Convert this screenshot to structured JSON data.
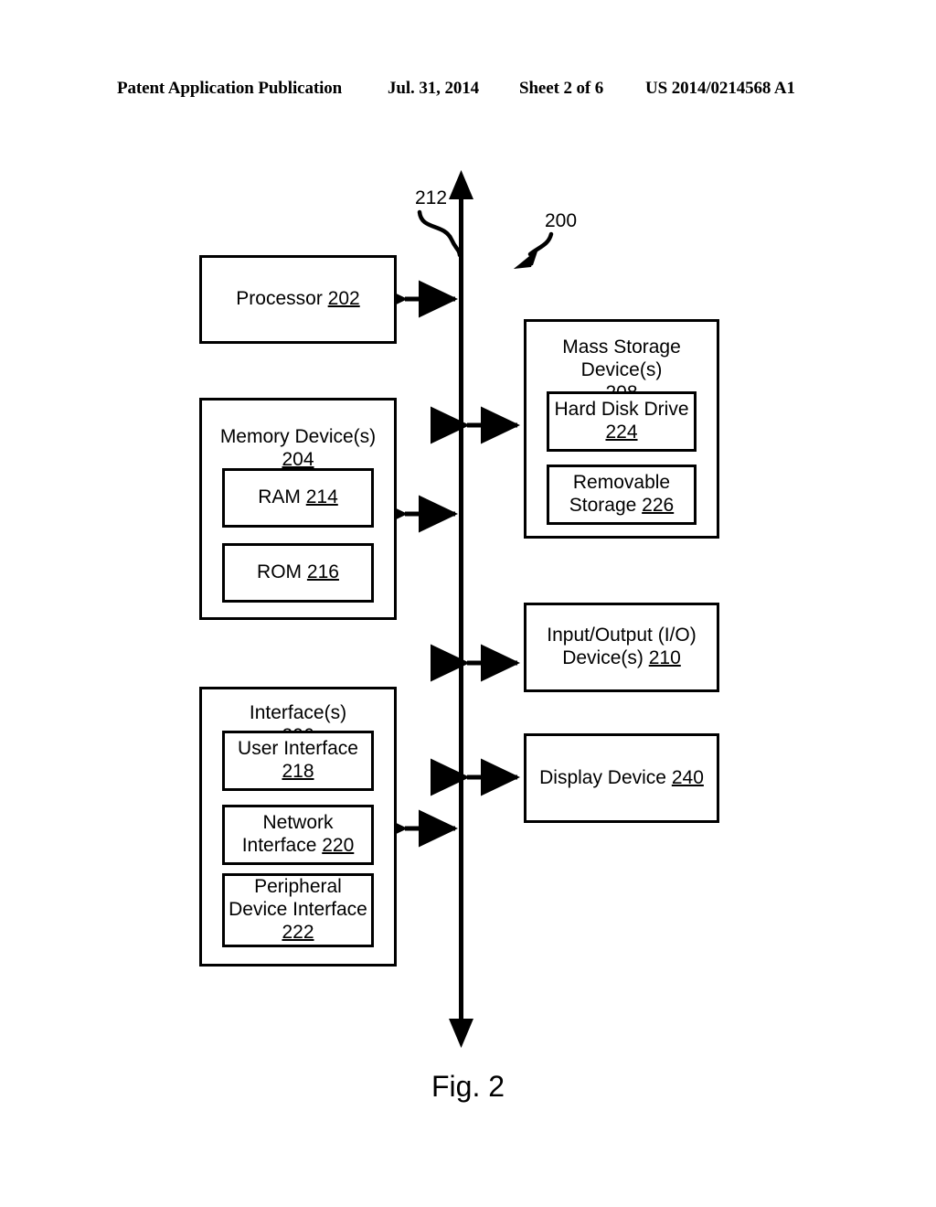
{
  "header": {
    "publication": "Patent Application Publication",
    "date": "Jul. 31, 2014",
    "sheet": "Sheet 2 of 6",
    "patent_number": "US 2014/0214568 A1"
  },
  "figure": {
    "caption": "Fig. 2",
    "system_ref": "200",
    "bus_ref": "212"
  },
  "blocks": {
    "processor": {
      "label": "Processor",
      "ref": "202"
    },
    "memory": {
      "label": "Memory Device(s)",
      "ref": "204",
      "children": [
        {
          "label": "RAM",
          "ref": "214"
        },
        {
          "label": "ROM",
          "ref": "216"
        }
      ]
    },
    "interfaces": {
      "label": "Interface(s)",
      "ref": "206",
      "children": [
        {
          "label": "User Interface",
          "ref": "218"
        },
        {
          "label": "Network\nInterface",
          "ref": "220"
        },
        {
          "label": "Peripheral\nDevice Interface",
          "ref": "222"
        }
      ]
    },
    "mass_storage": {
      "label": "Mass Storage\nDevice(s)",
      "ref": "208",
      "children": [
        {
          "label": "Hard Disk Drive",
          "ref": "224"
        },
        {
          "label": "Removable\nStorage",
          "ref": "226"
        }
      ]
    },
    "io_devices": {
      "label": "Input/Output (I/O)\nDevice(s)",
      "ref": "210"
    },
    "display_device": {
      "label": "Display Device",
      "ref": "240"
    }
  },
  "colors": {
    "ink": "#000000",
    "paper": "#ffffff"
  }
}
